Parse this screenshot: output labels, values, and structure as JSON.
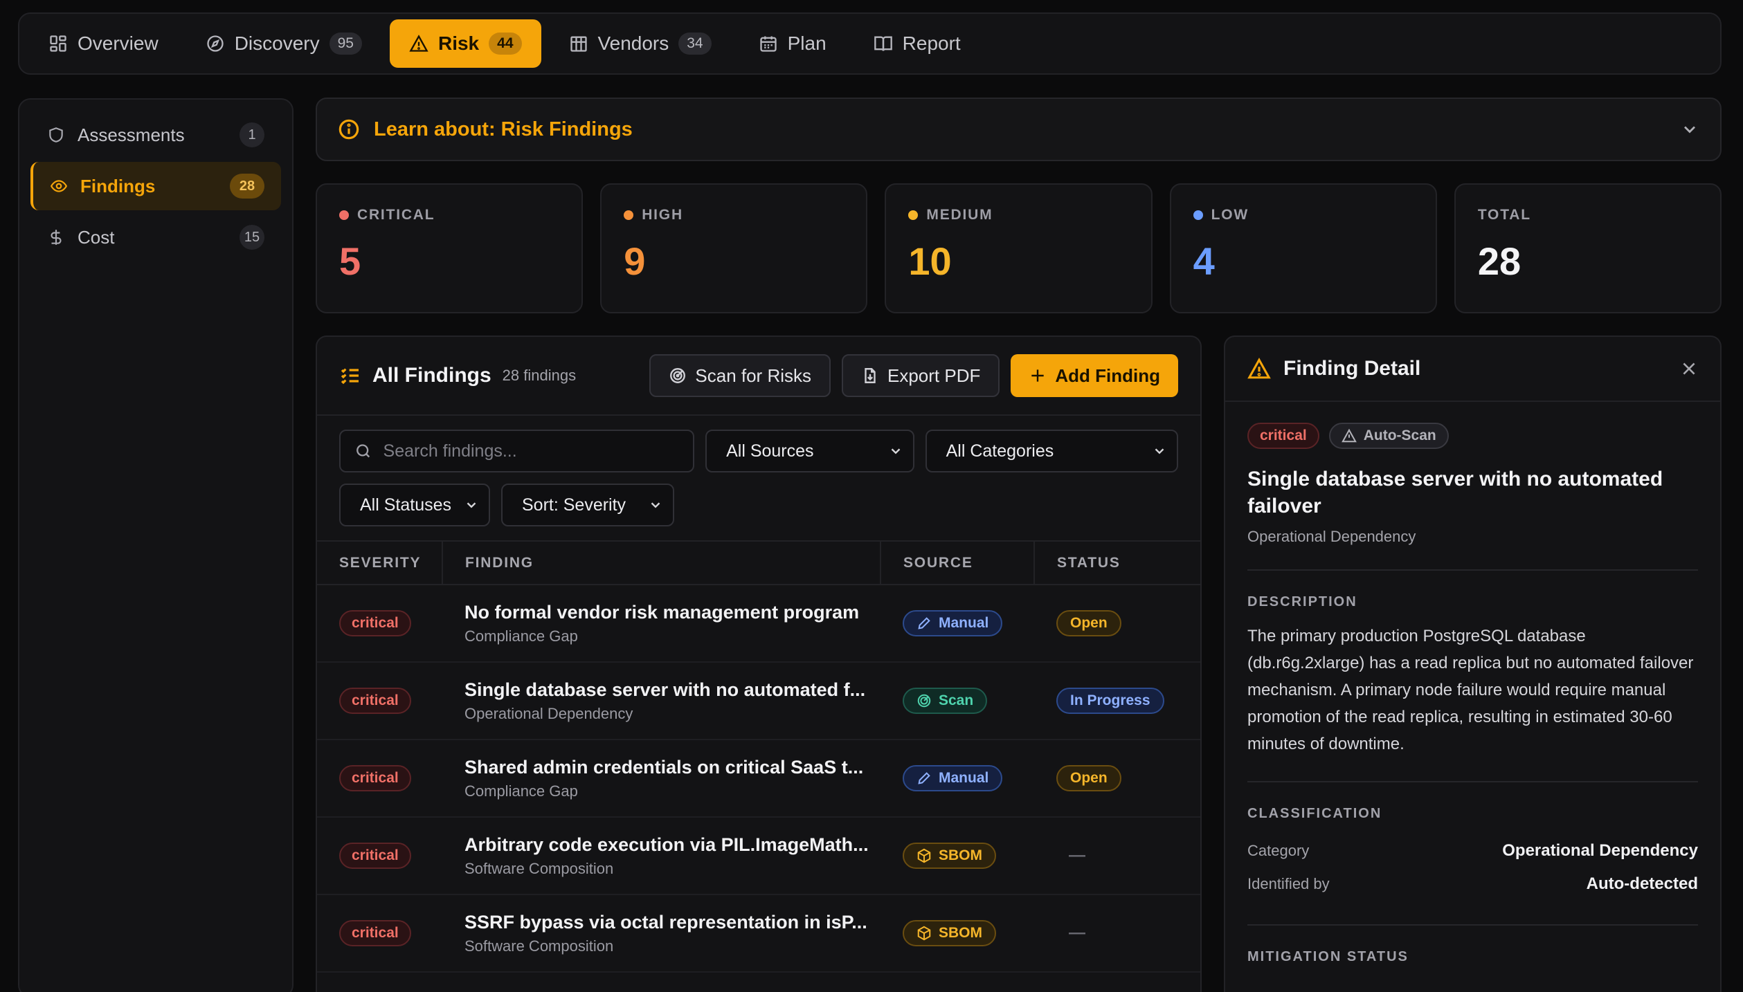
{
  "tabs": [
    {
      "label": "Overview",
      "badge": "",
      "icon": "grid-icon"
    },
    {
      "label": "Discovery",
      "badge": "95",
      "icon": "compass-icon"
    },
    {
      "label": "Risk",
      "badge": "44",
      "icon": "warning-icon"
    },
    {
      "label": "Vendors",
      "badge": "34",
      "icon": "building-icon"
    },
    {
      "label": "Plan",
      "badge": "",
      "icon": "calendar-icon"
    },
    {
      "label": "Report",
      "badge": "",
      "icon": "book-icon"
    }
  ],
  "sidebar": {
    "items": [
      {
        "label": "Assessments",
        "count": "1"
      },
      {
        "label": "Findings",
        "count": "28"
      },
      {
        "label": "Cost",
        "count": "15"
      }
    ]
  },
  "learn": {
    "label": "Learn about: Risk Findings"
  },
  "stats": [
    {
      "label": "CRITICAL",
      "value": "5",
      "color": "#f07067"
    },
    {
      "label": "HIGH",
      "value": "9",
      "color": "#f5913a"
    },
    {
      "label": "MEDIUM",
      "value": "10",
      "color": "#f5b52a"
    },
    {
      "label": "LOW",
      "value": "4",
      "color": "#6b9dff"
    },
    {
      "label": "TOTAL",
      "value": "28",
      "color": "#f4f4f6"
    }
  ],
  "findings": {
    "title": "All Findings",
    "subtitle": "28 findings",
    "scan_label": "Scan for Risks",
    "export_label": "Export PDF",
    "add_label": "Add Finding",
    "search_placeholder": "Search findings...",
    "filter_sources": "All Sources",
    "filter_categories": "All Categories",
    "filter_statuses": "All Statuses",
    "sort": "Sort: Severity",
    "columns": [
      "SEVERITY",
      "FINDING",
      "SOURCE",
      "STATUS"
    ],
    "rows": [
      {
        "severity": "critical",
        "title": "No formal vendor risk management program",
        "category": "Compliance Gap",
        "source": "Manual",
        "status": "Open"
      },
      {
        "severity": "critical",
        "title": "Single database server with no automated f...",
        "category": "Operational Dependency",
        "source": "Scan",
        "status": "In Progress"
      },
      {
        "severity": "critical",
        "title": "Shared admin credentials on critical SaaS t...",
        "category": "Compliance Gap",
        "source": "Manual",
        "status": "Open"
      },
      {
        "severity": "critical",
        "title": "Arbitrary code execution via PIL.ImageMath...",
        "category": "Software Composition",
        "source": "SBOM",
        "status": "—"
      },
      {
        "severity": "critical",
        "title": "SSRF bypass via octal representation in isP...",
        "category": "Software Composition",
        "source": "SBOM",
        "status": "—"
      }
    ]
  },
  "detail": {
    "header": "Finding Detail",
    "severity": "critical",
    "tag": "Auto-Scan",
    "title": "Single database server with no automated failover",
    "category": "Operational Dependency",
    "description_label": "DESCRIPTION",
    "description": "The primary production PostgreSQL database (db.r6g.2xlarge) has a read replica but no automated failover mechanism. A primary node failure would require manual promotion of the read replica, resulting in estimated 30-60 minutes of downtime.",
    "classification_label": "CLASSIFICATION",
    "category_key": "Category",
    "category_value": "Operational Dependency",
    "identified_key": "Identified by",
    "identified_value": "Auto-detected",
    "mitigation_label": "MITIGATION STATUS"
  }
}
